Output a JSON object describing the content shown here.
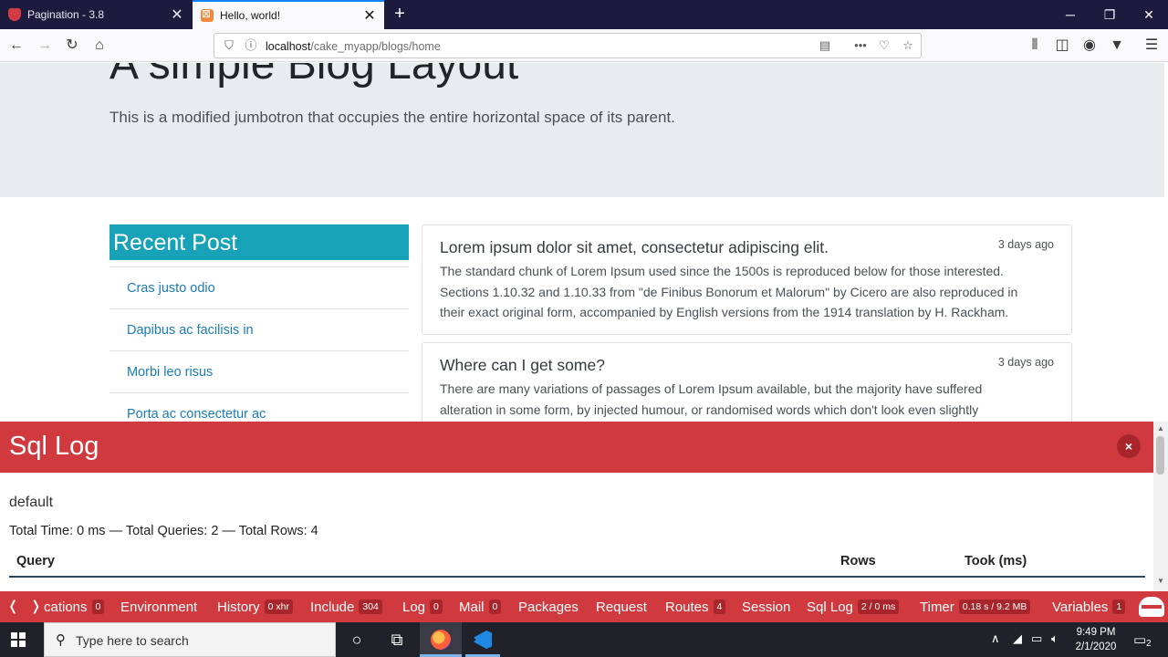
{
  "browser": {
    "tabs": [
      {
        "title": "Pagination - 3.8",
        "active": false
      },
      {
        "title": "Hello, world!",
        "active": true
      }
    ],
    "url": {
      "host": "localhost",
      "path": "/cake_myapp/blogs/home"
    }
  },
  "jumbotron": {
    "title": "A simple Blog Layout",
    "lead": "This is a modified jumbotron that occupies the entire horizontal space of its parent."
  },
  "sidebar": {
    "header": "Recent Post",
    "items": [
      "Cras justo odio",
      "Dapibus ac facilisis in",
      "Morbi leo risus",
      "Porta ac consectetur ac"
    ]
  },
  "posts": [
    {
      "title": "Lorem ipsum dolor sit amet, consectetur adipiscing elit.",
      "time": "3 days ago",
      "lines": [
        "The standard chunk of Lorem Ipsum used since the 1500s is reproduced below for those interested.",
        "Sections 1.10.32 and 1.10.33 from \"de Finibus Bonorum et Malorum\" by Cicero are also reproduced in",
        "their exact original form, accompanied by English versions from the 1914 translation by H. Rackham."
      ]
    },
    {
      "title": "Where can I get some?",
      "time": "3 days ago",
      "lines": [
        "There are many variations of passages of Lorem Ipsum available, but the majority have suffered",
        "alteration in some form, by injected humour, or randomised words which don't look even slightly"
      ]
    }
  ],
  "sql_log": {
    "title": "Sql Log",
    "close": "×",
    "connection": "default",
    "summary": "Total Time: 0 ms — Total Queries: 2 — Total Rows: 4",
    "columns": {
      "query": "Query",
      "rows": "Rows",
      "took": "Took (ms)"
    }
  },
  "debug_toolbar": {
    "prev": "❬",
    "next": "❭",
    "items": [
      {
        "label": "cations",
        "badge": "0"
      },
      {
        "label": "Environment",
        "badge": ""
      },
      {
        "label": "History",
        "badge": "0 xhr"
      },
      {
        "label": "Include",
        "badge": "304"
      },
      {
        "label": "Log",
        "badge": "0"
      },
      {
        "label": "Mail",
        "badge": "0"
      },
      {
        "label": "Packages",
        "badge": ""
      },
      {
        "label": "Request",
        "badge": ""
      },
      {
        "label": "Routes",
        "badge": "4"
      },
      {
        "label": "Session",
        "badge": ""
      },
      {
        "label": "Sql Log",
        "badge": "2 / 0 ms"
      },
      {
        "label": "Timer",
        "badge": "0.18 s / 9.2 MB"
      },
      {
        "label": "Variables",
        "badge": "1"
      }
    ]
  },
  "taskbar": {
    "search_placeholder": "Type here to search",
    "time": "9:49 PM",
    "date": "2/1/2020",
    "notification_count": "2"
  }
}
